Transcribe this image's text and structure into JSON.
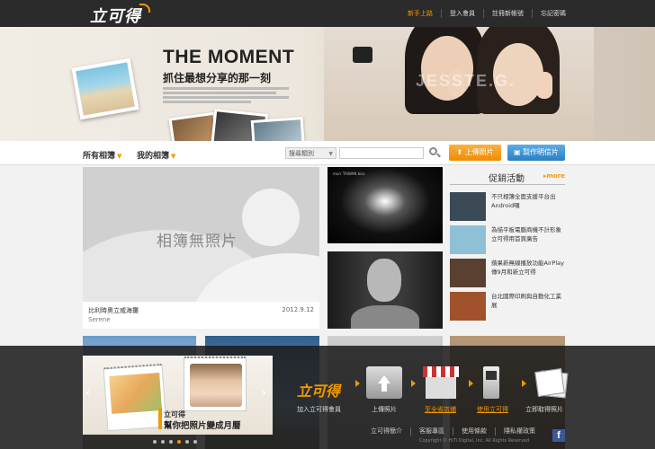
{
  "header": {
    "logo": "立可得",
    "nav": [
      "新手上路",
      "登入會員",
      "註冊新帳號",
      "忘記密碼"
    ]
  },
  "hero": {
    "title": "THE MOMENT",
    "subtitle": "抓住最想分享的那一刻",
    "watermark": "JESSTE.G."
  },
  "toolbar": {
    "tab_all": "所有相簿",
    "tab_mine": "我的相簿",
    "category_select": "搜尋類別",
    "search_placeholder": "",
    "upload_label": "上傳照片",
    "make_label": "製作明信片"
  },
  "album": {
    "empty_text": "相簿無照片",
    "title": "比利時奧立威海攤",
    "date": "2012.9.12",
    "user": "Serene"
  },
  "thumbs": {
    "tunnel_caption": "morr TAIWAN bsiz"
  },
  "promo": {
    "title": "促銷活動",
    "more": "▸more",
    "items": [
      {
        "text": "不只相簿全面支援平台出Android囉",
        "color": "#3a4a56"
      },
      {
        "text": "為描平板電腦商機不計形象立可得用首頁廣告",
        "color": "#8fc1d6"
      },
      {
        "text": "蘋果新無線播放功能AirPlay傳9月和新立可得",
        "color": "#5a4030"
      },
      {
        "text": "台北國際印刷與自動化工業展",
        "color": "#a0522d"
      }
    ]
  },
  "slider": {
    "brand": "立可得",
    "slogan": "幫你把照片變成月曆",
    "dots": 6,
    "active_dot": 3
  },
  "steps": {
    "logo": "立可得",
    "labels": [
      "加入立可得會員",
      "上傳照片",
      "至全省店鋪",
      "使用立可得",
      "立即取得照片"
    ]
  },
  "footer": {
    "links": [
      "立可得簡介",
      "客服專區",
      "使用條款",
      "隱私權政策"
    ],
    "copyright": "Copyright © HiTi Digital, Inc. All Rights Reserved",
    "facebook": "f"
  },
  "colors": {
    "accent": "#f39800",
    "blue_button": "#2a7fc1",
    "topbar": "#2b2b2b"
  }
}
